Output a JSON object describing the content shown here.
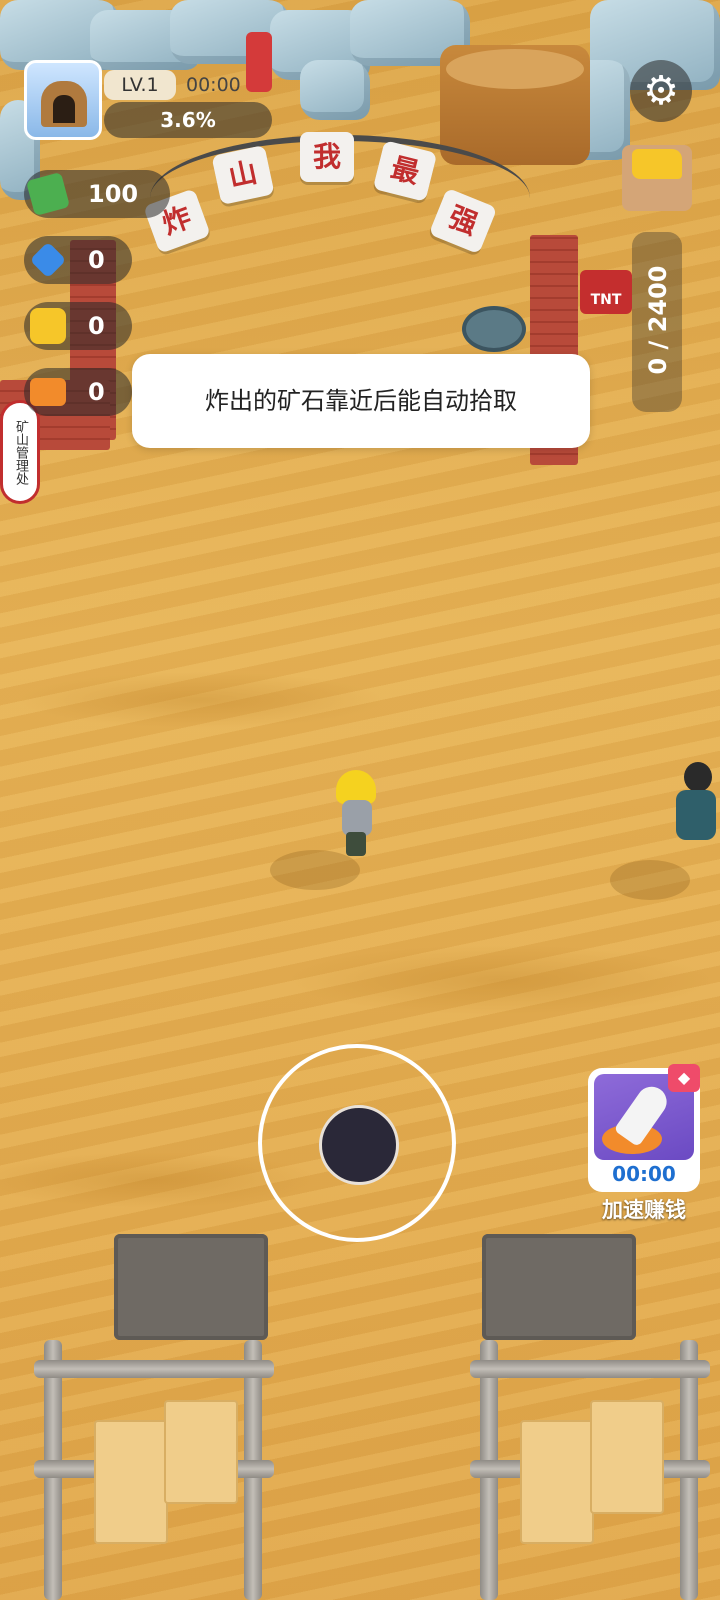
{
  "hud": {
    "level": "LV.1",
    "top_timer": "00:00",
    "progress_percent": "3.6%",
    "resources": [
      {
        "name": "cash",
        "icon": "cash-icon",
        "value": "100"
      },
      {
        "name": "diamond",
        "icon": "diamond-icon",
        "value": "0"
      },
      {
        "name": "gold",
        "icon": "gold-ore-icon",
        "value": "0"
      },
      {
        "name": "ticket",
        "icon": "ticket-icon",
        "value": "0"
      }
    ],
    "settings_icon": "gear-icon"
  },
  "arch_sign": [
    "炸",
    "山",
    "我",
    "最",
    "强"
  ],
  "side_sign": "矿山管理处",
  "tnt_label": "TNT",
  "tip_text": "炸出的矿石靠近后能自动拾取",
  "storage": {
    "capacity_text": "0 / 2400",
    "icon": "gold-ore-icon"
  },
  "boost": {
    "timer": "00:00",
    "label": "加速赚钱",
    "icon": "rocket-icon",
    "badge_icon": "diamond-icon"
  },
  "colors": {
    "sand": "#e0a94a",
    "tip_bg": "#ffffff",
    "hud_pill": "#282828",
    "boost_timer": "#1e6fd0",
    "sign_text": "#c12e2e"
  }
}
